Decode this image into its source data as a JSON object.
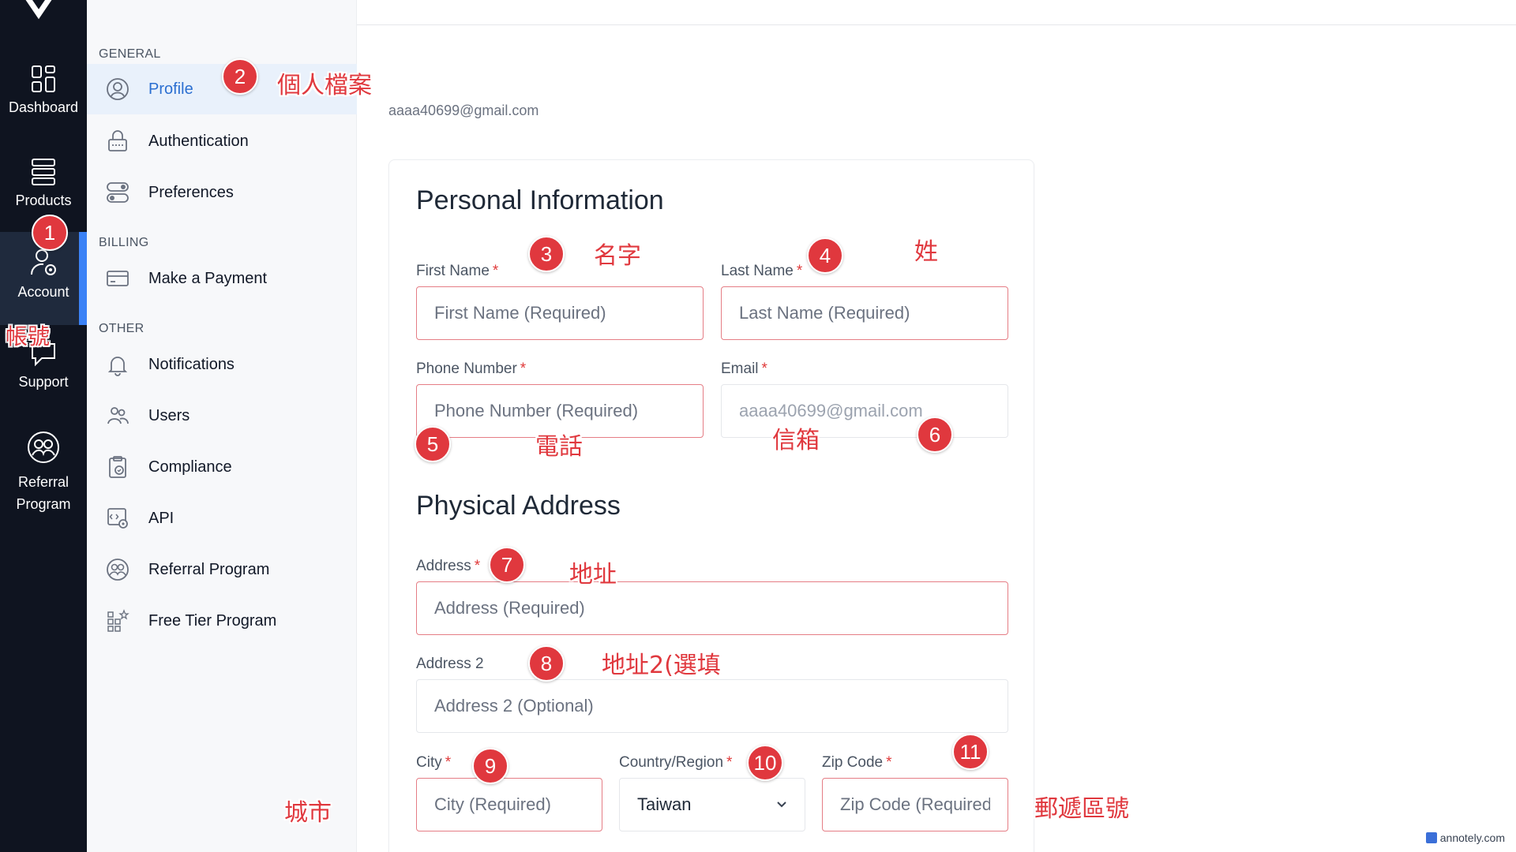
{
  "rail": {
    "items": [
      {
        "label": "Dashboard"
      },
      {
        "label": "Products"
      },
      {
        "label": "Account"
      },
      {
        "label": "Support"
      },
      {
        "label": "Referral Program"
      }
    ]
  },
  "sidebar": {
    "sections": {
      "general": "GENERAL",
      "billing": "BILLING",
      "other": "OTHER"
    },
    "items": [
      {
        "label": "Profile",
        "icon": "user-circle-icon"
      },
      {
        "label": "Authentication",
        "icon": "lock-icon"
      },
      {
        "label": "Preferences",
        "icon": "toggle-icon"
      },
      {
        "label": "Make a Payment",
        "icon": "credit-card-icon"
      },
      {
        "label": "Notifications",
        "icon": "bell-icon"
      },
      {
        "label": "Users",
        "icon": "users-icon"
      },
      {
        "label": "Compliance",
        "icon": "clipboard-check-icon"
      },
      {
        "label": "API",
        "icon": "code-gear-icon"
      },
      {
        "label": "Referral Program",
        "icon": "referral-icon"
      },
      {
        "label": "Free Tier Program",
        "icon": "grid-star-icon"
      }
    ]
  },
  "header": {
    "email": "aaaa40699@gmail.com"
  },
  "form": {
    "personal_title": "Personal Information",
    "address_title": "Physical Address",
    "first_name": {
      "label": "First Name",
      "placeholder": "First Name (Required)"
    },
    "last_name": {
      "label": "Last Name",
      "placeholder": "Last Name (Required)"
    },
    "phone": {
      "label": "Phone Number",
      "placeholder": "Phone Number (Required)"
    },
    "email": {
      "label": "Email",
      "value": "aaaa40699@gmail.com"
    },
    "address": {
      "label": "Address",
      "placeholder": "Address (Required)"
    },
    "address2": {
      "label": "Address 2",
      "placeholder": "Address 2 (Optional)"
    },
    "city": {
      "label": "City",
      "placeholder": "City (Required)"
    },
    "country": {
      "label": "Country/Region",
      "value": "Taiwan"
    },
    "zip": {
      "label": "Zip Code",
      "placeholder": "Zip Code (Required)"
    },
    "required_mark": "*"
  },
  "annotations": {
    "badges": [
      "1",
      "2",
      "3",
      "4",
      "5",
      "6",
      "7",
      "8",
      "9",
      "10",
      "11"
    ],
    "notes": {
      "account": "帳號",
      "profile": "個人檔案",
      "first_name": "名字",
      "last_name": "姓",
      "phone": "電話",
      "email": "信箱",
      "address": "地址",
      "address2": "地址2(選填",
      "city": "城市",
      "zip": "郵遞區號"
    }
  },
  "watermark": "annotely.com",
  "colors": {
    "accent": "#2b6fd1",
    "rail_bg": "#0f1420",
    "required": "#e03a3a",
    "badge": "#e0383e"
  }
}
